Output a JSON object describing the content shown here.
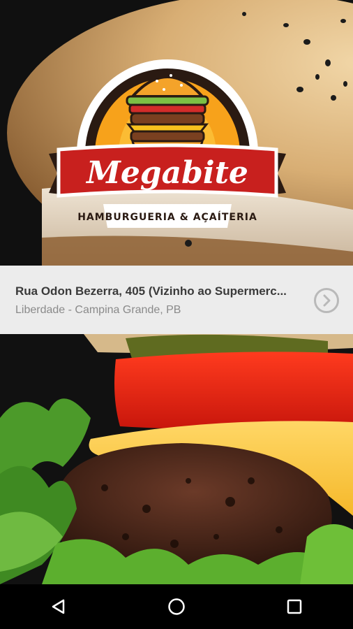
{
  "brand": {
    "name": "Megabite",
    "tagline": "HAMBURGUERIA & AÇAÍTERIA"
  },
  "location": {
    "address": "Rua Odon Bezerra, 405 (Vizinho ao Supermerc...",
    "district": "Liberdade - Campina Grande, PB",
    "action_icon": "chevron-right-circle-icon"
  },
  "navigation": {
    "back_icon": "back-triangle-icon",
    "home_icon": "home-circle-icon",
    "recents_icon": "recents-square-icon"
  },
  "colors": {
    "logo_red": "#c8201e",
    "logo_orange": "#f7a21b",
    "logo_brown": "#2a1a12",
    "address_bg": "#ececec"
  }
}
